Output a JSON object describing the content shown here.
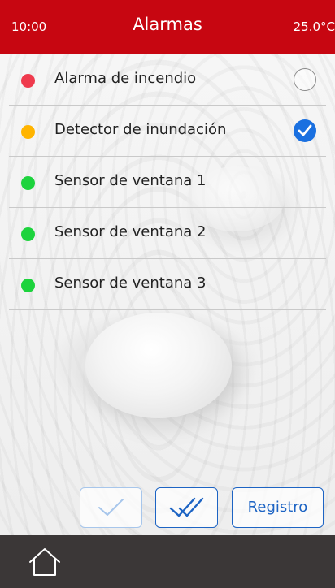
{
  "header": {
    "time": "10:00",
    "title": "Alarmas",
    "temperature": "25.0°C",
    "background_color": "#c70611"
  },
  "alarms": [
    {
      "label": "Alarma de incendio",
      "status_color": "#ef3a4d",
      "checkbox": "unchecked"
    },
    {
      "label": "Detector de inundación",
      "status_color": "#ffb400",
      "checkbox": "checked"
    },
    {
      "label": "Sensor de ventana 1",
      "status_color": "#1dd33d",
      "checkbox": "none"
    },
    {
      "label": "Sensor de ventana 2",
      "status_color": "#1dd33d",
      "checkbox": "none"
    },
    {
      "label": "Sensor de ventana 3",
      "status_color": "#1dd33d",
      "checkbox": "none"
    }
  ],
  "actions": {
    "acknowledge_icon": "check-icon",
    "acknowledge_all_icon": "double-check-icon",
    "log_label": "Registro",
    "accent_color": "#1d64c4"
  },
  "footer": {
    "home_icon": "home-icon",
    "background_color": "#3b3737"
  }
}
